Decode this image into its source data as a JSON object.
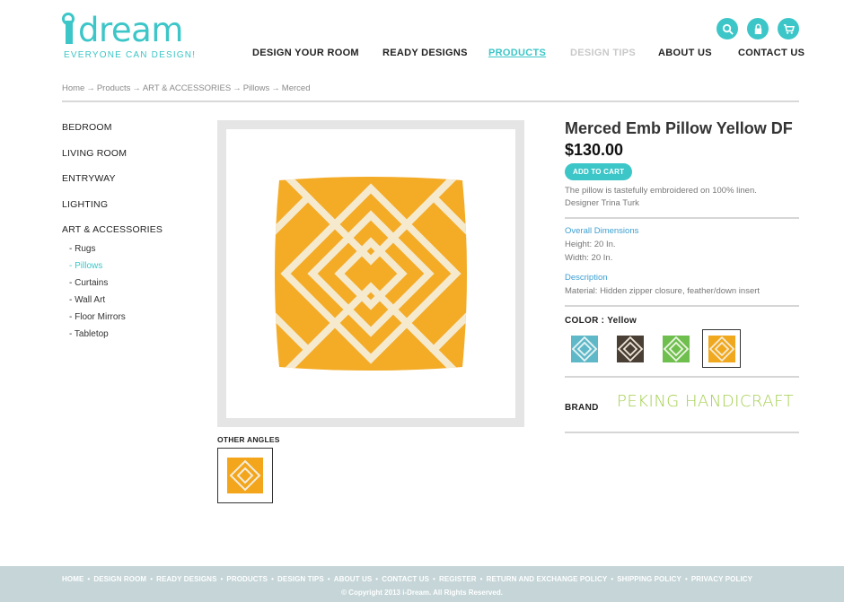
{
  "brand": {
    "logo_text": "dream",
    "tagline": "EVERYONE CAN DESIGN!"
  },
  "header_icons": [
    "search-icon",
    "lock-icon",
    "cart-icon"
  ],
  "nav": {
    "items": [
      {
        "label": "DESIGN YOUR ROOM",
        "state": "normal"
      },
      {
        "label": "READY DESIGNS",
        "state": "normal"
      },
      {
        "label": "PRODUCTS",
        "state": "active"
      },
      {
        "label": "DESIGN TIPS",
        "state": "muted"
      },
      {
        "label": "ABOUT US",
        "state": "normal"
      },
      {
        "label": "CONTACT US",
        "state": "normal"
      }
    ]
  },
  "breadcrumb": [
    "Home",
    "Products",
    "ART & ACCESSORIES",
    "Pillows",
    "Merced"
  ],
  "breadcrumb_sep": "→",
  "sidebar": {
    "categories": [
      "BEDROOM",
      "LIVING ROOM",
      "ENTRYWAY",
      "LIGHTING",
      "ART & ACCESSORIES"
    ],
    "subcategories": [
      "- Rugs",
      "- Pillows",
      "- Curtains",
      "- Wall Art",
      "- Floor Mirrors",
      "- Tabletop"
    ],
    "active_sub": "- Pillows"
  },
  "product": {
    "title": "Merced Emb Pillow Yellow DF",
    "price": "$130.00",
    "add_to_cart": "ADD TO CART",
    "description_1": "The pillow is tastefully embroidered on 100% linen.",
    "description_2": "Designer Trina Turk",
    "dimensions_heading": "Overall Dimensions",
    "height": "Height: 20 In.",
    "width": "Width: 20 In.",
    "description_heading": "Description",
    "material": "Material: Hidden zipper closure, feather/down insert",
    "color_label": "COLOR : Yellow",
    "brand_label": "BRAND",
    "brand_name": "PEKING HANDICRAFT",
    "other_angles": "OTHER ANGLES"
  },
  "swatches": [
    {
      "name": "blue",
      "color": "#5fb8c8"
    },
    {
      "name": "black",
      "color": "#4a3f35"
    },
    {
      "name": "green",
      "color": "#6fbf4e"
    },
    {
      "name": "yellow",
      "color": "#f0a81f"
    }
  ],
  "colors": {
    "accent": "#3cc6c8",
    "link": "#3c9fd1",
    "brand_green": "#a3cf4f",
    "pillow_yellow": "#f0a81f",
    "footer_bg": "#c5d5d8"
  },
  "footer": {
    "links": [
      "HOME",
      "DESIGN ROOM",
      "READY DESIGNS",
      "PRODUCTS",
      "DESIGN TIPS",
      "ABOUT US",
      "CONTACT US",
      "REGISTER",
      "RETURN AND EXCHANGE POLICY",
      "SHIPPING POLICY",
      "PRIVACY POLICY"
    ],
    "copyright": "© Copyright 2013 i-Dream. All Rights Reserved."
  }
}
